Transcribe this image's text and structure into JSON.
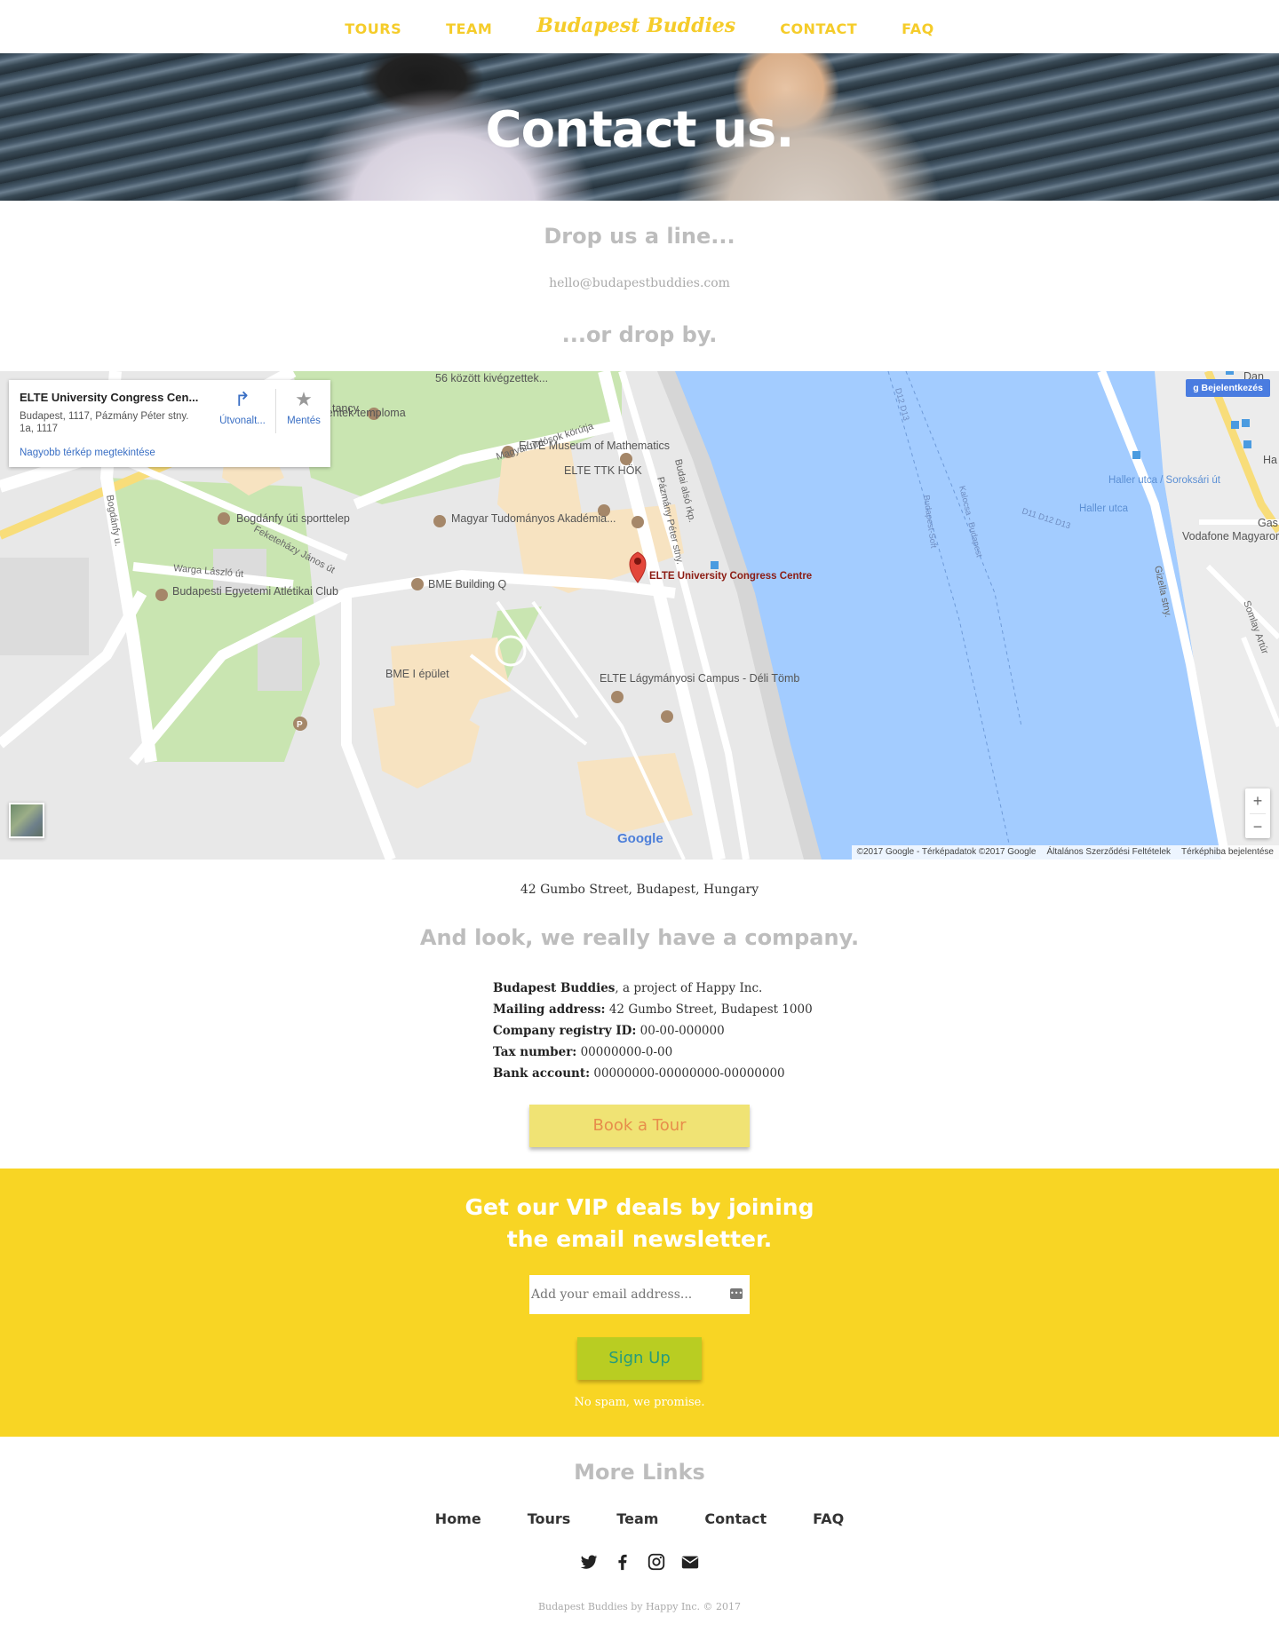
{
  "nav": {
    "tours": "TOURS",
    "team": "TEAM",
    "brand": "Budapest Buddies",
    "contact": "CONTACT",
    "faq": "FAQ"
  },
  "hero": {
    "title": "Contact us."
  },
  "contact": {
    "drop_line": "Drop us a line...",
    "email": "hello@budapestbuddies.com",
    "drop_by": "...or drop by."
  },
  "map": {
    "card_title": "ELTE University Congress Cen...",
    "card_address": "Budapest, 1117, Pázmány Péter stny. 1a, 1117",
    "card_link": "Nagyobb térkép megtekintése",
    "directions_label": "Útvonalt...",
    "save_label": "Mentés",
    "login_label": "Bejelentkezés",
    "zoom_in": "+",
    "zoom_out": "−",
    "google_logo": "Google",
    "attribution": [
      "©2017 Google - Térképadatok ©2017 Google",
      "Általános Szerződési Feltételek",
      "Térképhiba bejelentése"
    ],
    "labels": {
      "elte_congress": "ELTE University Congress Centre",
      "elte_museum": "ELTE Museum of Mathematics",
      "elte_ttk": "ELTE TTK HÖK",
      "mta": "Magyar Tudományos Akadémia...",
      "bme_q": "BME Building Q",
      "bme_i": "BME I épület",
      "elte_lagy": "ELTE Lágymányosi Campus - Déli Tömb",
      "szentek": "Magyar Szentek temploma",
      "bogdanfy_sport": "Bogdánfy úti sporttelep",
      "bea_club": "Budapesti Egyetemi Atlétikai Club",
      "kivegzettek": "56 között kivégzettek...",
      "tancy": "tancy",
      "haller_soroksari": "Haller utca / Soroksári út",
      "haller_utca": "Haller utca",
      "vodafone": "Vodafone Magyarország Zrt",
      "gas": "Gas",
      "ha": "Ha",
      "dan": "Dan",
      "road_budai": "Budai alsó rkp.",
      "road_pazmany": "Pázmány Péter stny.",
      "road_magyar_tudosok": "Magyar tudósok körútja",
      "road_bogdanfy": "Bogdánfy u.",
      "road_feketehazy": "Feketeházy János út",
      "road_warga": "Warga László út",
      "road_gizella": "Gizella stny.",
      "road_somlay": "Somlay Artúr",
      "river_kalocsa": "Kalocsa - Budapest",
      "river_soft": "Budapest-Soft",
      "river_d": "D11 D12 D13",
      "river_d2": "D12 D13",
      "parking": "P"
    }
  },
  "address": "42 Gumbo Street, Budapest, Hungary",
  "company": {
    "title": "And look, we really have a company.",
    "name_label": "Budapest Buddies",
    "name_value": ", a project of Happy Inc.",
    "mailing_label": "Mailing address:",
    "mailing_value": "42 Gumbo Street, Budapest 1000",
    "registry_label": "Company registry ID:",
    "registry_value": "00-00-000000",
    "tax_label": "Tax number:",
    "tax_value": "00000000-0-00",
    "bank_label": "Bank account:",
    "bank_value": "00000000-00000000-00000000"
  },
  "book_button": "Book a Tour",
  "newsletter": {
    "title_line1": "Get our VIP deals by joining",
    "title_line2": "the email newsletter.",
    "placeholder": "Add your email address...",
    "signup": "Sign Up",
    "note": "No spam, we promise."
  },
  "footer": {
    "title": "More Links",
    "links": [
      "Home",
      "Tours",
      "Team",
      "Contact",
      "FAQ"
    ],
    "social_icons": [
      "twitter-icon",
      "facebook-icon",
      "instagram-icon",
      "envelope-icon"
    ],
    "copyright": "Budapest Buddies by Happy Inc. © 2017"
  },
  "colors": {
    "brand_yellow": "#f8d524",
    "nav_yellow": "#f5cc2a",
    "button_yellow": "#f0e374",
    "button_orange_text": "#e78d4b",
    "signup_green": "#b9cd22",
    "signup_text": "#269b7b",
    "heading_grey": "#bdbdbd",
    "river_blue": "#a3ccff"
  }
}
